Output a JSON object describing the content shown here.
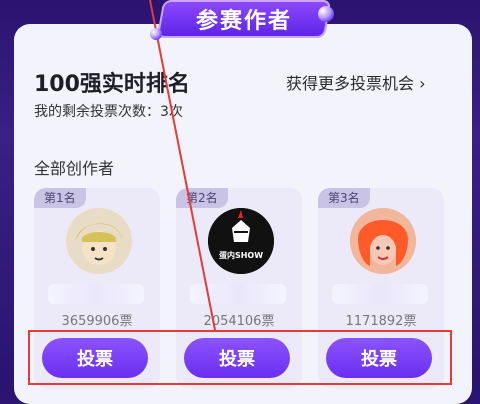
{
  "header": {
    "title": "参赛作者"
  },
  "ranking": {
    "title": "100强实时排名",
    "remaining_votes": "我的剩余投票次数：3次",
    "more_link": "获得更多投票机会 ›"
  },
  "section": {
    "label": "全部创作者"
  },
  "creators": [
    {
      "rank": "第1名",
      "votes": "3659906票",
      "button": "投票",
      "avatar_icon": "anime-avatar-icon"
    },
    {
      "rank": "第2名",
      "votes": "2054106票",
      "button": "投票",
      "avatar_icon": "unicorn-show-logo-icon",
      "avatar_logo_text": "蛋内SHOW"
    },
    {
      "rank": "第3名",
      "votes": "1171892票",
      "button": "投票",
      "avatar_icon": "orange-hair-avatar-icon"
    }
  ],
  "colors": {
    "background": "#2a1470",
    "panel": "#f3f3fb",
    "accent": "#6b2ff0",
    "highlight": "#e53b3b"
  }
}
